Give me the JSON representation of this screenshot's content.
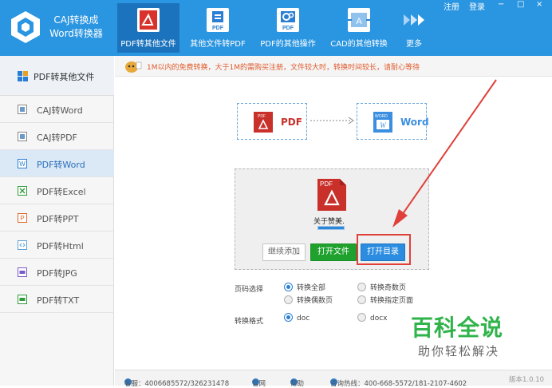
{
  "app": {
    "title_line1": "CAJ转换成",
    "title_line2": "Word转换器"
  },
  "nav": [
    {
      "label": "PDF转其他文件",
      "icon": "pdf-icon"
    },
    {
      "label": "其他文件转PDF",
      "icon": "doc-to-pdf-icon"
    },
    {
      "label": "PDF的其他操作",
      "icon": "pdf-gear-icon"
    },
    {
      "label": "CAD的其他转换",
      "icon": "cad-icon"
    },
    {
      "label": "更多",
      "icon": "more-arrows-icon"
    }
  ],
  "window": {
    "register": "注册",
    "login": "登录",
    "minimize": "−",
    "maximize": "□",
    "close": "×"
  },
  "sidebar": {
    "header": "PDF转其他文件",
    "items": [
      {
        "label": "CAJ转Word"
      },
      {
        "label": "CAJ转PDF"
      },
      {
        "label": "PDF转Word"
      },
      {
        "label": "PDF转Excel"
      },
      {
        "label": "PDF转PPT"
      },
      {
        "label": "PDF转Html"
      },
      {
        "label": "PDF转JPG"
      },
      {
        "label": "PDF转TXT"
      }
    ]
  },
  "notice": "1M以内的免费转换，大于1M的需购买注册，文件较大时，转换时间较长，请耐心等待",
  "flow": {
    "from_label": "PDF",
    "to_label": "Word",
    "pdf_badge": "PDF",
    "word_badge": "WORD"
  },
  "file": {
    "badge": "PDF",
    "name": "关于赞美.",
    "progress": 1.0
  },
  "buttons": {
    "continue": "继续添加",
    "open_file": "打开文件",
    "open_dir": "打开目录"
  },
  "options": {
    "page_label": "页码选择",
    "page_all": "转换全部",
    "page_odd": "转换奇数页",
    "page_even": "转换偶数页",
    "page_custom": "转换指定页面",
    "format_label": "转换格式",
    "format_doc": "doc",
    "format_docx": "docx"
  },
  "watermark": {
    "main": "百科全说",
    "sub": "助你轻松解决"
  },
  "status": {
    "qq": "客服：4006685572/326231478",
    "site": "官网",
    "help": "帮助",
    "hotline": "咨询热线：400-668-5572/181-2107-4602",
    "version": "版本1.0.10"
  },
  "colors": {
    "header": "#2a95e0",
    "accent": "#2c8de0",
    "green_button": "#1fa12d",
    "highlight_red": "#e0403a",
    "watermark": "#2fb34a"
  }
}
